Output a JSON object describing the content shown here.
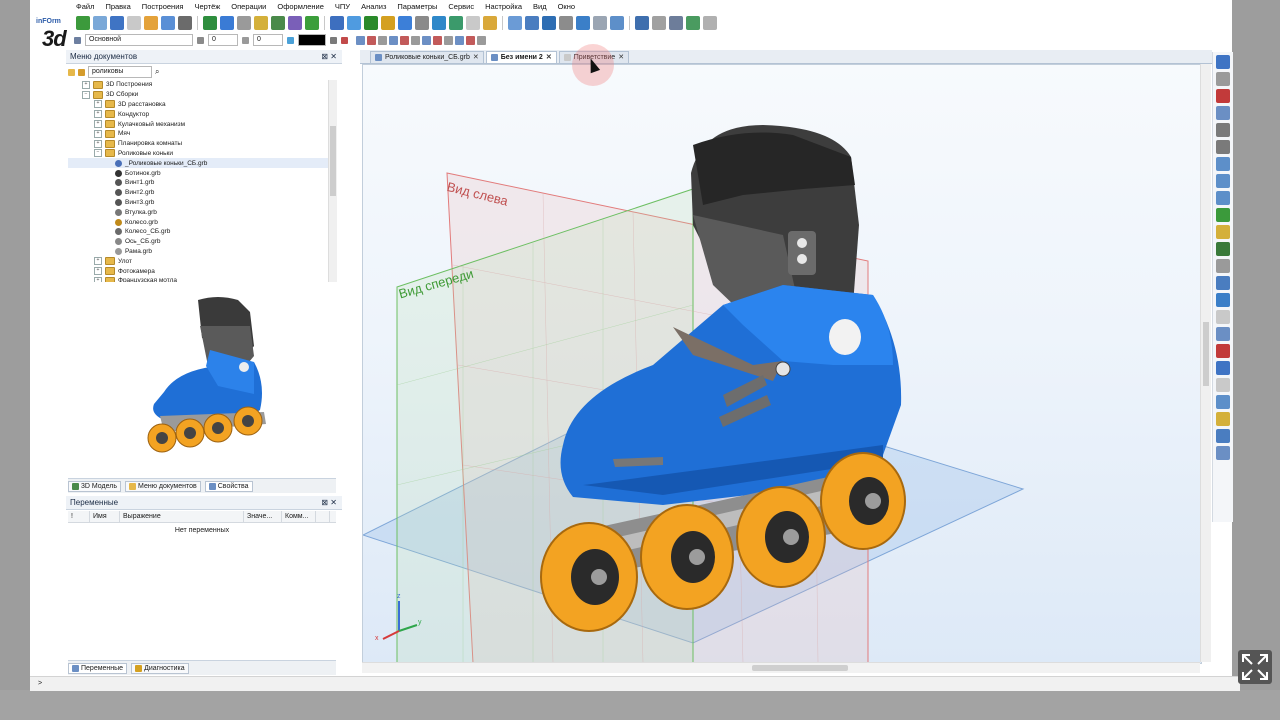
{
  "app": {
    "logo_small": "inFOrm",
    "logo_big": "3d"
  },
  "menu": [
    "Файл",
    "Правка",
    "Построения",
    "Чертёж",
    "Операции",
    "Оформление",
    "ЧПУ",
    "Анализ",
    "Параметры",
    "Сервис",
    "Настройка",
    "Вид",
    "Окно"
  ],
  "toolbar2": {
    "style_value": "Основной",
    "field_a": "0",
    "field_b": "0"
  },
  "doc_panel": {
    "title": "Меню документов",
    "search_value": "роликовы",
    "tree": [
      {
        "label": "3D Построения",
        "level": 1,
        "kind": "folder",
        "expander": "+"
      },
      {
        "label": "3D Сборки",
        "level": 1,
        "kind": "folder",
        "expander": "−"
      },
      {
        "label": "3D расстановка",
        "level": 2,
        "kind": "folder",
        "expander": "+"
      },
      {
        "label": "Кондуктор",
        "level": 2,
        "kind": "folder",
        "expander": "+"
      },
      {
        "label": "Кулачковый механизм",
        "level": 2,
        "kind": "folder",
        "expander": "+"
      },
      {
        "label": "Мяч",
        "level": 2,
        "kind": "folder",
        "expander": "+"
      },
      {
        "label": "Планировка комнаты",
        "level": 2,
        "kind": "folder",
        "expander": "+"
      },
      {
        "label": "Роликовые коньки",
        "level": 2,
        "kind": "folder",
        "expander": "−"
      },
      {
        "label": "_Роликовые коньки_СБ.grb",
        "level": 3,
        "kind": "file",
        "color": "#4a70b8",
        "selected": true
      },
      {
        "label": "Ботинок.grb",
        "level": 3,
        "kind": "file",
        "color": "#333333"
      },
      {
        "label": "Винт1.grb",
        "level": 3,
        "kind": "file",
        "color": "#555555"
      },
      {
        "label": "Винт2.grb",
        "level": 3,
        "kind": "file",
        "color": "#555555"
      },
      {
        "label": "Винт3.grb",
        "level": 3,
        "kind": "file",
        "color": "#555555"
      },
      {
        "label": "Втулка.grb",
        "level": 3,
        "kind": "file",
        "color": "#777777"
      },
      {
        "label": "Колесо.grb",
        "level": 3,
        "kind": "file",
        "color": "#c08a1a"
      },
      {
        "label": "Колесо_СБ.grb",
        "level": 3,
        "kind": "file",
        "color": "#6a6a6a"
      },
      {
        "label": "Ось_СБ.grb",
        "level": 3,
        "kind": "file",
        "color": "#888888"
      },
      {
        "label": "Рама.grb",
        "level": 3,
        "kind": "file",
        "color": "#999999"
      },
      {
        "label": "Улот",
        "level": 2,
        "kind": "folder",
        "expander": "+"
      },
      {
        "label": "Фотокамера",
        "level": 2,
        "kind": "folder",
        "expander": "+"
      },
      {
        "label": "Французская мотла",
        "level": 2,
        "kind": "folder",
        "expander": "+"
      }
    ],
    "tabs": [
      "3D Модель",
      "Меню документов",
      "Свойства"
    ]
  },
  "vars_panel": {
    "title": "Переменные",
    "columns": [
      "!",
      "Имя",
      "Выражение",
      "Значе...",
      "Комм...",
      ""
    ],
    "empty_text": "Нет переменных",
    "tabs": [
      "Переменные",
      "Диагностика"
    ]
  },
  "viewport": {
    "tabs": [
      {
        "label": "Роликовые коньки_СБ.grb",
        "active": false
      },
      {
        "label": "Без имени 2",
        "active": true
      },
      {
        "label": "Приветствие",
        "active": false
      }
    ],
    "plane_left_label": "Вид слева",
    "plane_front_label": "Вид спереди",
    "colors": {
      "boot_blue": "#1f6fd6",
      "wheel_orange": "#f3a322",
      "plane_red": "#e27b7b",
      "plane_green": "#6cbf62",
      "plane_blue": "#8ab4e6"
    },
    "axis_labels": {
      "z": "z",
      "x": "x",
      "y": "y"
    }
  },
  "status": {
    "prompt": ">"
  }
}
